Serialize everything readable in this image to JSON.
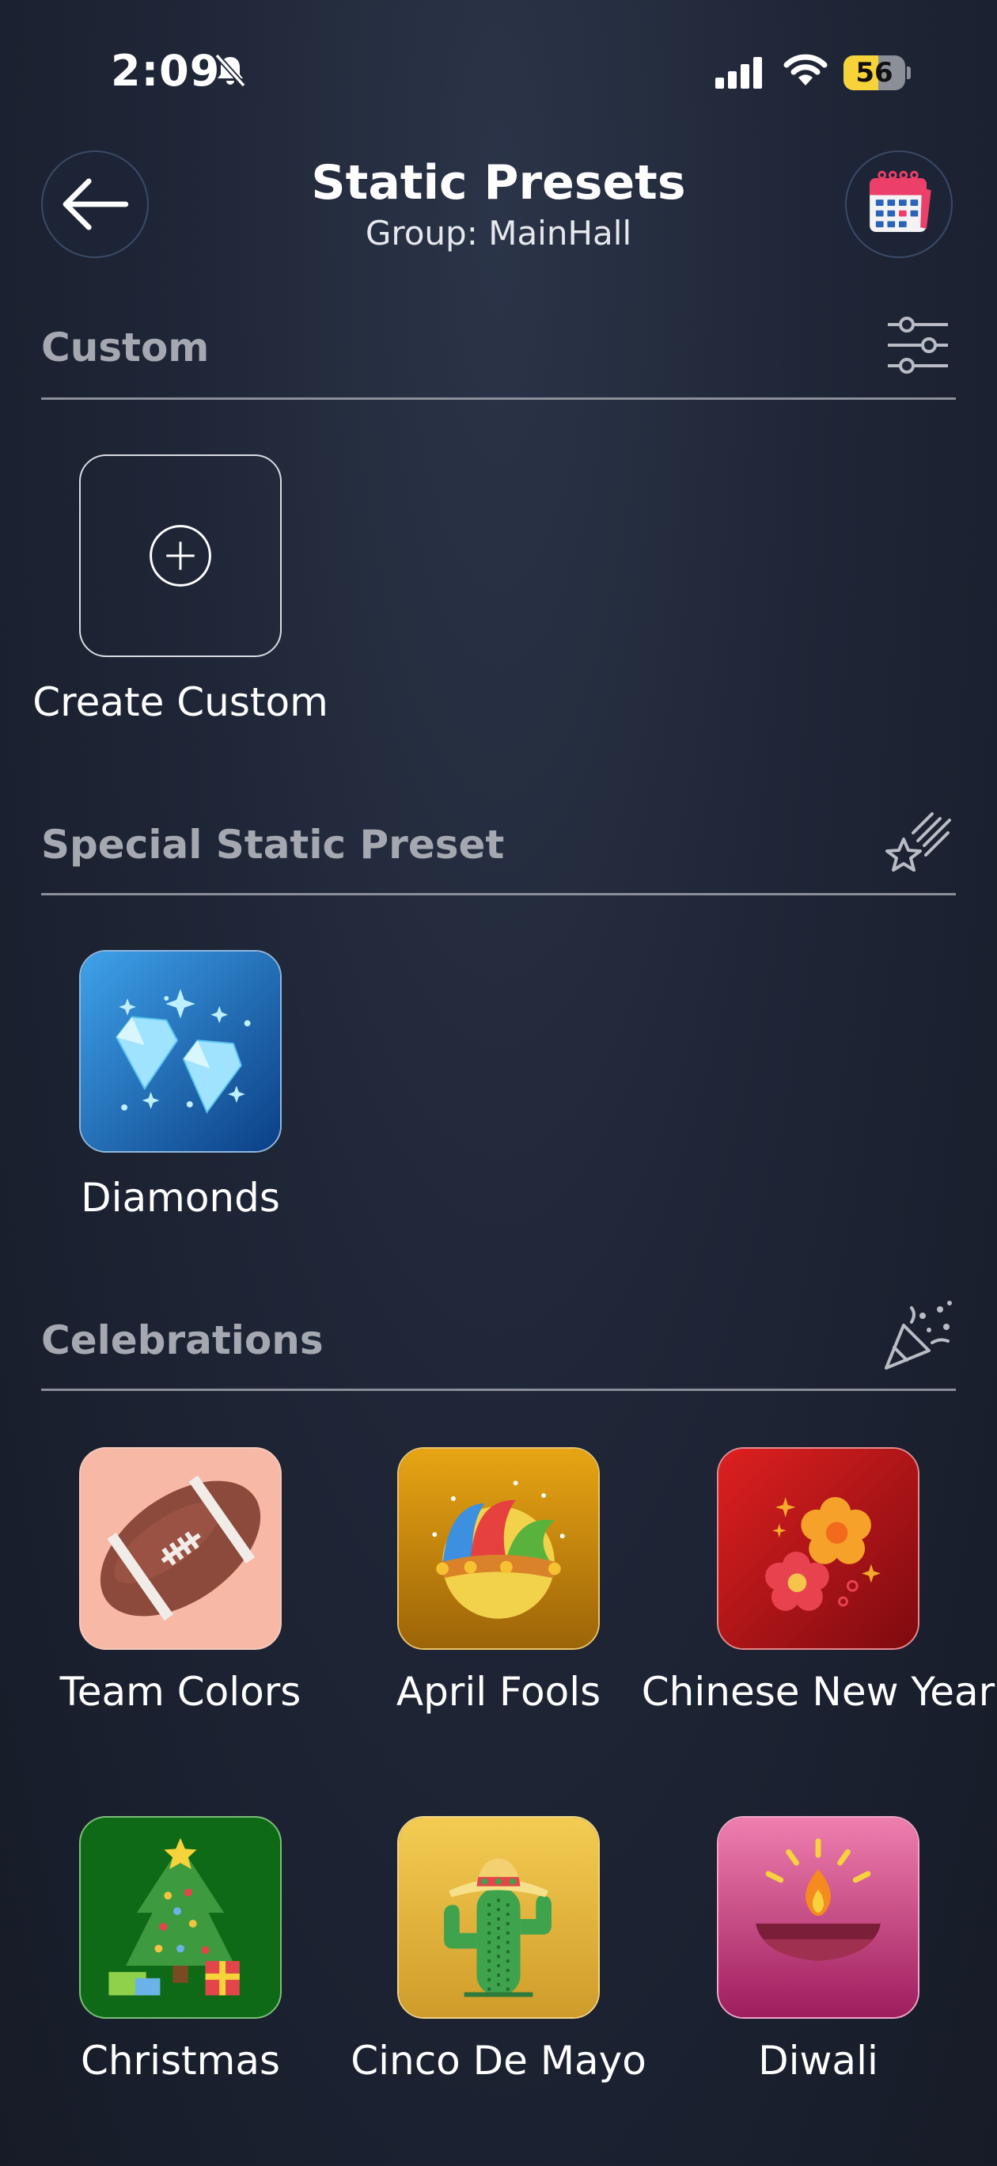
{
  "status_bar": {
    "time": "2:09",
    "battery_level": 56,
    "battery_text": "56",
    "battery_color": "#f7d33a",
    "icons": [
      "bell-slash-icon",
      "cellular-signal-icon",
      "wifi-icon",
      "battery-icon"
    ]
  },
  "header": {
    "title": "Static Presets",
    "subtitle": "Group: MainHall",
    "back_icon": "arrow-left-icon",
    "calendar_icon": "calendar-icon"
  },
  "sections": {
    "custom": {
      "title": "Custom",
      "icon": "sliders-icon",
      "items": [
        {
          "label": "Create Custom",
          "icon": "plus-circle-icon"
        }
      ]
    },
    "special": {
      "title": "Special Static Preset",
      "icon": "shooting-star-icon",
      "items": [
        {
          "label": "Diamonds",
          "icon": "diamonds-icon",
          "color": "#1c6fc4"
        }
      ]
    },
    "celebrations": {
      "title": "Celebrations",
      "icon": "party-popper-icon",
      "items": [
        {
          "label": "Team Colors",
          "icon": "football-icon",
          "color": "#f8b8a6"
        },
        {
          "label": "April Fools",
          "icon": "jester-hat-icon",
          "color": "#d18f0f"
        },
        {
          "label": "Chinese New Year",
          "icon": "plum-blossom-icon",
          "color": "#b8141c"
        },
        {
          "label": "Christmas",
          "icon": "christmas-tree-icon",
          "color": "#0e6a17"
        },
        {
          "label": "Cinco De Mayo",
          "icon": "cactus-sombrero-icon",
          "color": "#e9b93c"
        },
        {
          "label": "Diwali",
          "icon": "diya-lamp-icon",
          "color": "#d14d8d"
        }
      ]
    }
  }
}
